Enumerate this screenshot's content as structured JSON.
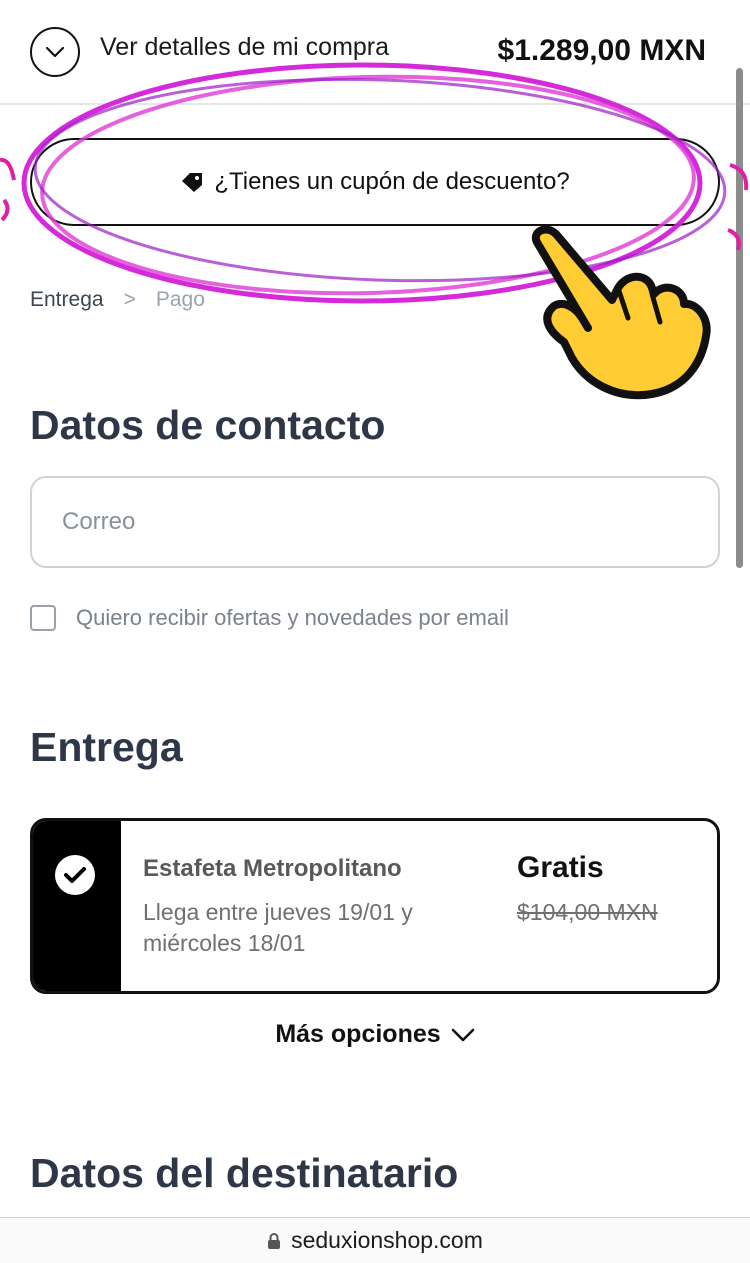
{
  "order_summary": {
    "toggle_label": "Ver detalles de mi compra",
    "total": "$1.289,00 MXN"
  },
  "coupon": {
    "label": "¿Tienes un cupón de descuento?"
  },
  "breadcrumb": {
    "current": "Entrega",
    "separator": ">",
    "next": "Pago"
  },
  "contact": {
    "heading": "Datos de contacto",
    "email_placeholder": "Correo",
    "email_value": "",
    "newsletter_label": "Quiero recibir ofertas y novedades por email",
    "newsletter_checked": false
  },
  "delivery": {
    "heading": "Entrega",
    "option": {
      "name": "Estafeta Metropolitano",
      "eta": "Llega entre jueves 19/01 y miércoles 18/01",
      "price": "Gratis",
      "original_price": "$104,00 MXN",
      "selected": true
    },
    "more_options_label": "Más opciones"
  },
  "recipient": {
    "heading": "Datos del destinatario"
  },
  "browser": {
    "domain": "seduxionshop.com"
  },
  "colors": {
    "highlight": "#d21fd8",
    "heading_text": "#2d3748",
    "selected_bar": "#000000"
  },
  "icons": [
    "chevron-down-icon",
    "tag-icon",
    "check-icon",
    "lock-icon",
    "pointing-hand-icon"
  ]
}
